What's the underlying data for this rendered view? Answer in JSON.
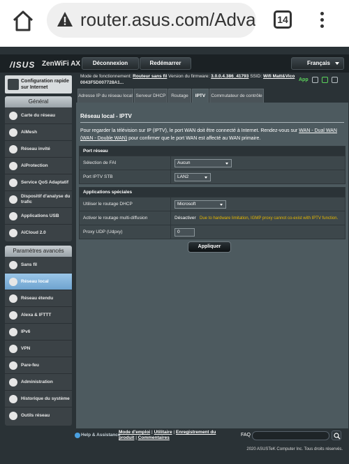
{
  "browser": {
    "url": "router.asus.com/Adva",
    "tab_count": "14"
  },
  "header": {
    "logo": "/ISUS",
    "model": "ZenWiFi AX",
    "logout_label": "Déconnexion",
    "reboot_label": "Redémarrer",
    "language": "Français"
  },
  "sidebar": {
    "quick_setup": "Configuration rapide sur Internet",
    "general_title": "Général",
    "general_items": [
      {
        "label": "Carte du réseau"
      },
      {
        "label": "AiMesh"
      },
      {
        "label": "Réseau invité"
      },
      {
        "label": "AiProtection"
      },
      {
        "label": "Service QoS Adaptatif"
      },
      {
        "label": "Dispositif d'analyse du trafic"
      },
      {
        "label": "Applications USB"
      },
      {
        "label": "AiCloud 2.0"
      }
    ],
    "advanced_title": "Paramètres avancés",
    "advanced_items": [
      {
        "label": "Sans fil"
      },
      {
        "label": "Réseau local"
      },
      {
        "label": "Réseau étendu"
      },
      {
        "label": "Alexa & IFTTT"
      },
      {
        "label": "IPv6"
      },
      {
        "label": "VPN"
      },
      {
        "label": "Pare-feu"
      },
      {
        "label": "Administration"
      },
      {
        "label": "Historique du système"
      },
      {
        "label": "Outils réseau"
      }
    ]
  },
  "info": {
    "mode_label": "Mode de fonctionnement:",
    "mode_value": "Routeur sans fil",
    "fw_label": "Version du firmware:",
    "fw_value": "3.0.0.4.386_41793",
    "ssid_label": "SSID:",
    "ssid_value": "Wifi Matt&Vico",
    "serial": "0043F5D007728A1...",
    "app_label": "App"
  },
  "tabs": [
    {
      "label": "Adresse IP du réseau local"
    },
    {
      "label": "Serveur DHCP"
    },
    {
      "label": "Routage"
    },
    {
      "label": "IPTV"
    },
    {
      "label": "Commutateur de contrôle"
    }
  ],
  "main": {
    "title": "Réseau local - IPTV",
    "desc_prefix": "Pour regarder la télévision sur IP (IPTV), le port WAN doit être connecté à Internet. Rendez-vous sur ",
    "desc_link": "WAN - Dual WAN (WAN - Double WAN)",
    "desc_suffix": " pour confirmer que le port WAN est affecté au WAN primaire.",
    "port_section": {
      "title": "Port réseau",
      "isp_label": "Sélection de FAI",
      "isp_value": "Aucun",
      "stb_label": "Port IPTV STB",
      "stb_value": "LAN2"
    },
    "special_section": {
      "title": "Applications spéciales",
      "dhcp_label": "Utiliser le routage DHCP",
      "dhcp_value": "Microsoft",
      "multicast_label": "Activer le routage multi-diffusion",
      "multicast_value": "Désactiver",
      "multicast_note": "Due to hardware limitation, IGMP proxy cannot co-exist with IPTV function.",
      "udp_label": "Proxy UDP (Udpxy)",
      "udp_value": "0"
    },
    "apply_label": "Appliquer"
  },
  "footer": {
    "help": "Help & Assistance",
    "manual": "Mode d'emploi",
    "sep": " | ",
    "utility": "Utilitaire",
    "register": "Enregistrement du produit",
    "comments": "Commentaires",
    "faq": "FAQ",
    "copyright": "2020 ASUSTeK Computer Inc. Tous droits réservés."
  }
}
